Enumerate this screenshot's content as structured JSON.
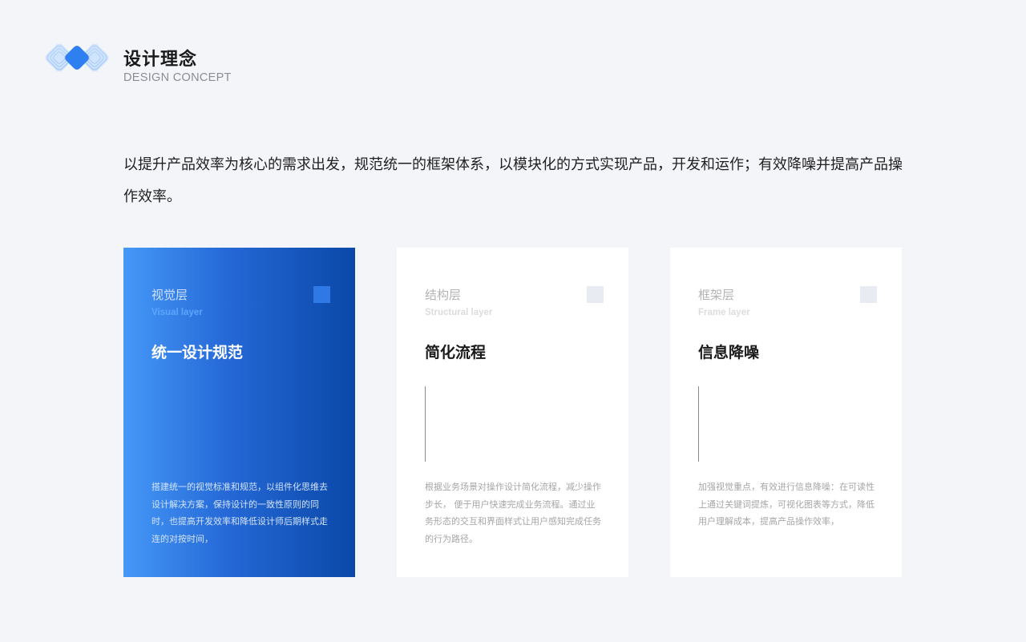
{
  "header": {
    "title": "设计理念",
    "subtitle": "DESIGN CONCEPT",
    "logo_icon": "diamond-pattern-logo-icon"
  },
  "intro": "以提升产品效率为核心的需求出发，规范统一的框架体系，以模块化的方式实现产品，开发和运作；有效降噪并提高产品操作效率。",
  "colors": {
    "background": "#f4f5f9",
    "card_blue_start": "#4598f8",
    "card_blue_end": "#0a48a8",
    "card_white": "#ffffff"
  },
  "cards": [
    {
      "layer_cn": "视觉层",
      "layer_en": "Visual layer",
      "heading": "统一设计规范",
      "desc": "搭建统一的视觉标准和规范，以组件化思维去设计解决方案，保持设计的一致性原则的同时，也提高开发效率和降低设计师后期样式走连的对按时间，"
    },
    {
      "layer_cn": "结构层",
      "layer_en": "Structural layer",
      "heading": "简化流程",
      "desc": "根据业务场景对操作设计简化流程，减少操作步长， 便于用户快速完成业务流程。通过业务形态的交互和界面样式让用户感知完成任务的行为路径。"
    },
    {
      "layer_cn": "框架层",
      "layer_en": "Frame layer",
      "heading": "信息降噪",
      "desc": "加强视觉重点，有效进行信息降噪：在可读性上通过关键词提炼，可视化图表等方式，降低用户理解成本，提高产品操作效率，"
    }
  ]
}
